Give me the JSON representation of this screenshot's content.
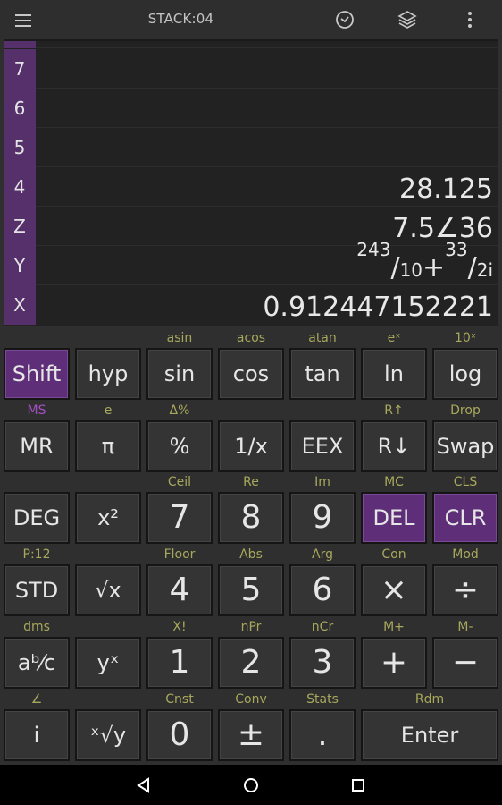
{
  "topbar": {
    "menu_icon": "hamburger-menu-icon",
    "title": "STACK:04",
    "actions": [
      {
        "name": "history-icon"
      },
      {
        "name": "layers-icon"
      },
      {
        "name": "more-vert-icon"
      }
    ]
  },
  "stack": {
    "rows": [
      {
        "label": "",
        "value": ""
      },
      {
        "label": "7",
        "value": ""
      },
      {
        "label": "6",
        "value": ""
      },
      {
        "label": "5",
        "value": ""
      },
      {
        "label": "4",
        "value": "28.125"
      },
      {
        "label": "Z",
        "value": "7.5∠36"
      },
      {
        "label": "Y",
        "value_parts": {
          "n1": "243",
          "d1": "10",
          "plus": "+",
          "n2": "33",
          "d2": "2i"
        }
      },
      {
        "label": "X",
        "value": "0.912447152221"
      }
    ]
  },
  "keypad": {
    "rows": [
      [
        {
          "sec": "",
          "label": "Shift",
          "style": "purple"
        },
        {
          "sec": "",
          "label": "hyp"
        },
        {
          "sec": "asin",
          "label": "sin"
        },
        {
          "sec": "acos",
          "label": "cos"
        },
        {
          "sec": "atan",
          "label": "tan"
        },
        {
          "sec": "eˣ",
          "label": "ln"
        },
        {
          "sec": "10ˣ",
          "label": "log"
        }
      ],
      [
        {
          "sec": "MS",
          "sec_style": "mag",
          "label": "MR"
        },
        {
          "sec": "e",
          "label": "π"
        },
        {
          "sec": "Δ%",
          "label": "%"
        },
        {
          "sec": "",
          "label": "1/x"
        },
        {
          "sec": "",
          "label": "EEX"
        },
        {
          "sec": "R↑",
          "label": "R↓"
        },
        {
          "sec": "Drop",
          "label": "Swap"
        }
      ],
      [
        {
          "sec": "",
          "label": "DEG"
        },
        {
          "sec": "",
          "label": "x²"
        },
        {
          "sec": "Ceil",
          "label": "7",
          "big": true
        },
        {
          "sec": "Re",
          "label": "8",
          "big": true
        },
        {
          "sec": "Im",
          "label": "9",
          "big": true
        },
        {
          "sec": "MC",
          "label": "DEL",
          "style": "purple"
        },
        {
          "sec": "CLS",
          "label": "CLR",
          "style": "purple"
        }
      ],
      [
        {
          "sec": "P:12",
          "label": "STD"
        },
        {
          "sec": "",
          "label": "√x"
        },
        {
          "sec": "Floor",
          "label": "4",
          "big": true
        },
        {
          "sec": "Abs",
          "label": "5",
          "big": true
        },
        {
          "sec": "Arg",
          "label": "6",
          "big": true
        },
        {
          "sec": "Con",
          "label": "×",
          "big": true
        },
        {
          "sec": "Mod",
          "label": "÷",
          "big": true
        }
      ],
      [
        {
          "sec": "dms",
          "label": "aᵇ⁄c"
        },
        {
          "sec": "",
          "label": "yˣ"
        },
        {
          "sec": "X!",
          "label": "1",
          "big": true
        },
        {
          "sec": "nPr",
          "label": "2",
          "big": true
        },
        {
          "sec": "nCr",
          "label": "3",
          "big": true
        },
        {
          "sec": "M+",
          "label": "+",
          "big": true
        },
        {
          "sec": "M-",
          "label": "−",
          "big": true
        }
      ],
      [
        {
          "sec": "∠",
          "label": "i"
        },
        {
          "sec": "",
          "label": "ˣ√y"
        },
        {
          "sec": "Cnst",
          "label": "0",
          "big": true
        },
        {
          "sec": "Conv",
          "label": "±",
          "big": true
        },
        {
          "sec": "Stats",
          "label": ".",
          "big": true
        },
        {
          "sec": "Rdm",
          "label": "Enter",
          "wide": true
        }
      ]
    ]
  },
  "navbar": {
    "buttons": [
      "back-icon",
      "home-icon",
      "recents-icon"
    ]
  }
}
